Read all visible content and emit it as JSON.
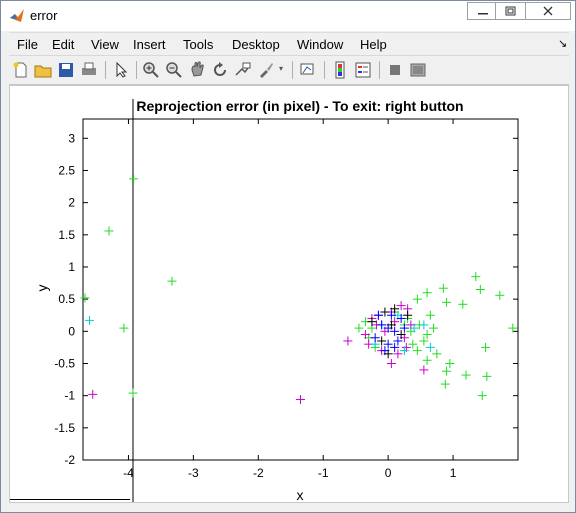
{
  "window": {
    "title": "error"
  },
  "menu": [
    "File",
    "Edit",
    "View",
    "Insert",
    "Tools",
    "Desktop",
    "Window",
    "Help"
  ],
  "toolbar_icons": [
    "new-file-icon",
    "open-folder-icon",
    "save-icon",
    "print-icon",
    "pointer-icon",
    "zoom-in-icon",
    "zoom-out-icon",
    "pan-icon",
    "rotate-icon",
    "data-cursor-icon",
    "brush-icon",
    "link-plot-icon",
    "colorbar-icon",
    "legend-icon",
    "hide-tools-icon",
    "show-tools-icon"
  ],
  "colors": {
    "green": "#22dd22",
    "magenta": "#cc00cc",
    "cyan": "#00cccc",
    "blue": "#0000ff",
    "black": "#000000",
    "grid_line": "#000000"
  },
  "chart_data": {
    "type": "scatter",
    "title": "Reprojection error (in pixel) - To exit: right button",
    "xlabel": "x",
    "ylabel": "y",
    "xlim": [
      -4.7,
      2.0
    ],
    "ylim": [
      -2,
      3.3
    ],
    "xticks": [
      -4,
      -3,
      -2,
      -1,
      0,
      1
    ],
    "yticks": [
      -2,
      -1.5,
      -1,
      -0.5,
      0,
      0.5,
      1,
      1.5,
      2,
      2.5,
      3
    ],
    "vertical_line_x": -3.93,
    "grid": false,
    "legend": "none",
    "marker": "+",
    "series": [
      {
        "color": "green",
        "points": [
          [
            -4.67,
            0.52
          ],
          [
            -4.3,
            1.56
          ],
          [
            -3.92,
            2.37
          ],
          [
            -4.07,
            0.05
          ],
          [
            -3.93,
            -0.96
          ],
          [
            -3.33,
            0.78
          ],
          [
            0.45,
            0.5
          ],
          [
            0.65,
            0.25
          ],
          [
            0.6,
            0.6
          ],
          [
            0.85,
            0.67
          ],
          [
            0.9,
            0.45
          ],
          [
            1.15,
            0.42
          ],
          [
            1.35,
            0.85
          ],
          [
            1.42,
            0.65
          ],
          [
            1.72,
            0.56
          ],
          [
            1.92,
            0.05
          ],
          [
            1.5,
            -0.25
          ],
          [
            0.75,
            -0.35
          ],
          [
            0.9,
            -0.62
          ],
          [
            0.95,
            -0.5
          ],
          [
            1.2,
            -0.68
          ],
          [
            1.52,
            -0.7
          ],
          [
            0.88,
            -0.82
          ],
          [
            1.45,
            -1.0
          ],
          [
            0.6,
            -0.45
          ],
          [
            0.7,
            0.05
          ],
          [
            -0.35,
            0.15
          ],
          [
            -0.3,
            -0.1
          ],
          [
            0.35,
            0.0
          ],
          [
            0.55,
            -0.15
          ],
          [
            0.48,
            0.1
          ],
          [
            -0.25,
            0.05
          ],
          [
            0.3,
            0.2
          ],
          [
            0.45,
            -0.3
          ],
          [
            0.25,
            0.1
          ],
          [
            -0.45,
            0.05
          ],
          [
            -0.2,
            -0.25
          ],
          [
            0.1,
            0.3
          ],
          [
            0.6,
            -0.05
          ],
          [
            0.38,
            -0.2
          ]
        ]
      },
      {
        "color": "magenta",
        "points": [
          [
            -4.55,
            -0.98
          ],
          [
            -1.35,
            -1.06
          ],
          [
            -0.62,
            -0.15
          ],
          [
            0.05,
            -0.5
          ],
          [
            0.55,
            -0.6
          ],
          [
            -0.15,
            0.25
          ],
          [
            0.2,
            0.4
          ],
          [
            0.3,
            0.35
          ],
          [
            -0.35,
            -0.05
          ],
          [
            0.15,
            -0.35
          ],
          [
            -0.05,
            0.0
          ],
          [
            0.25,
            -0.1
          ],
          [
            -0.25,
            0.2
          ],
          [
            0.1,
            0.15
          ],
          [
            0.35,
            0.1
          ],
          [
            -0.1,
            -0.3
          ],
          [
            0.05,
            0.3
          ],
          [
            -0.3,
            -0.2
          ],
          [
            0.28,
            -0.25
          ],
          [
            -0.18,
            0.1
          ]
        ]
      },
      {
        "color": "cyan",
        "points": [
          [
            -4.6,
            0.17
          ],
          [
            0.55,
            0.1
          ],
          [
            0.65,
            -0.25
          ],
          [
            -0.2,
            -0.2
          ],
          [
            0.15,
            0.25
          ],
          [
            0.4,
            0.05
          ],
          [
            -0.1,
            0.1
          ],
          [
            0.25,
            -0.3
          ]
        ]
      },
      {
        "color": "blue",
        "points": [
          [
            -0.1,
            0.1
          ],
          [
            0.1,
            0.0
          ],
          [
            0.0,
            -0.2
          ],
          [
            0.2,
            0.2
          ],
          [
            -0.2,
            -0.1
          ],
          [
            0.05,
            0.25
          ],
          [
            -0.05,
            -0.3
          ],
          [
            0.15,
            -0.15
          ],
          [
            0.25,
            0.05
          ],
          [
            -0.15,
            0.25
          ],
          [
            0.0,
            0.05
          ],
          [
            0.1,
            -0.25
          ]
        ]
      },
      {
        "color": "black",
        "points": [
          [
            -0.05,
            0.3
          ],
          [
            0.2,
            -0.05
          ],
          [
            -0.25,
            0.15
          ],
          [
            0.1,
            0.35
          ],
          [
            0.0,
            -0.35
          ],
          [
            -0.1,
            -0.15
          ],
          [
            0.3,
            0.25
          ],
          [
            0.05,
            0.1
          ]
        ]
      }
    ]
  }
}
